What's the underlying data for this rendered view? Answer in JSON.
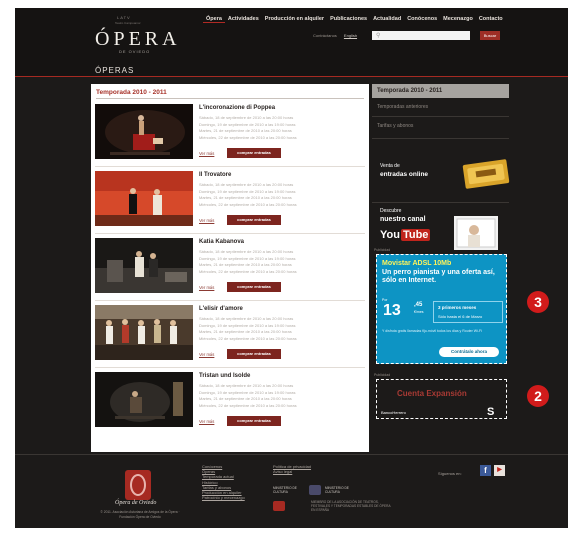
{
  "header": {
    "org_top": "LATV",
    "org_sub": "Teatro Campoamor",
    "logo": "ÓPERA",
    "logo_city": "DE OVIEDO",
    "nav": [
      "Ópera",
      "Actividades",
      "Producción en alquiler",
      "Publicaciones",
      "Actualidad",
      "Conócenos",
      "Mecenazgo",
      "Contacto"
    ],
    "contact_link": "Contráctanos",
    "lang_link": "English",
    "search_placeholder": "",
    "search_button": "Buscar"
  },
  "page_title": "ÓPERAS",
  "main": {
    "season_title": "Temporada 2010 - 2011",
    "more_label": "Ver más",
    "buy_label": "comprar entradas",
    "operas": [
      {
        "title": "L'incoronazione di Poppea",
        "dates": [
          "Sábado, 18 de septiembre de 2010 a las 20:00 horas",
          "Domingo, 19 de septiembre de 2010 a las 19:00 horas",
          "Martes, 21 de septiembre de 2010 a las 20:00 horas",
          "Miércoles, 22 de septiembre de 2010 a las 20:00 horas"
        ]
      },
      {
        "title": "Il Trovatore",
        "dates": [
          "Sábado, 18 de septiembre de 2010 a las 20:00 horas",
          "Domingo, 19 de septiembre de 2010 a las 19:00 horas",
          "Martes, 21 de septiembre de 2010 a las 20:00 horas",
          "Miércoles, 22 de septiembre de 2010 a las 20:00 horas"
        ]
      },
      {
        "title": "Katia Kabanova",
        "dates": [
          "Sábado, 18 de septiembre de 2010 a las 20:00 horas",
          "Domingo, 19 de septiembre de 2010 a las 19:00 horas",
          "Martes, 21 de septiembre de 2010 a las 20:00 horas",
          "Miércoles, 22 de septiembre de 2010 a las 20:00 horas"
        ]
      },
      {
        "title": "L'elisir d'amore",
        "dates": [
          "Sábado, 18 de septiembre de 2010 a las 20:00 horas",
          "Domingo, 19 de septiembre de 2010 a las 19:00 horas",
          "Martes, 21 de septiembre de 2010 a las 20:00 horas",
          "Miércoles, 22 de septiembre de 2010 a las 20:00 horas"
        ]
      },
      {
        "title": "Tristan und Isolde",
        "dates": [
          "Sábado, 18 de septiembre de 2010 a las 20:00 horas",
          "Domingo, 19 de septiembre de 2010 a las 19:00 horas",
          "Martes, 21 de septiembre de 2010 a las 20:00 horas",
          "Miércoles, 22 de septiembre de 2010 a las 20:00 horas"
        ]
      }
    ]
  },
  "sidebar": {
    "active": "Temporada 2010 - 2011",
    "items": [
      "Temporadas anteriores",
      "Tarifas y abonos"
    ],
    "promo_tickets_line1": "Venta de",
    "promo_tickets_line2": "entradas online",
    "promo_channel_line1": "Descubre",
    "promo_channel_line2": "nuestro canal",
    "youtube_you": "You",
    "youtube_tube": "Tube"
  },
  "ads": {
    "label": "Publicidad",
    "movistar": {
      "headline": "Movistar ADSL 10Mb",
      "body": "Un perro pianista y una oferta así, sólo en Internet.",
      "por": "Por",
      "price": "13",
      "cents": ",45",
      "unit": "€/mes",
      "box_line1": "3 primeros meses",
      "box_line2": "Sólo hasta el 6 de Marzo",
      "fine": "Y disfruta gratis llamadas fijo-móvil todos los días y Router Wi-Fi",
      "cta": "Contrátalo ahora"
    },
    "bank": {
      "headline": "Cuenta Expansión",
      "bank_name": "BancoHerrero",
      "logo": "S"
    }
  },
  "markers": [
    "3",
    "2"
  ],
  "footer": {
    "brand": "Ópera de Oviedo",
    "copyright": "© 2011. Asociación Asturiana de Amigos de la Ópera · Fundación Ópera de Oviedo",
    "col1": [
      "Conócenos",
      "Óperas",
      "Temporada actual",
      "Histórico",
      "Tarifas y abonos",
      "Producción en alquiler",
      "Patrocinio y mecenazgo"
    ],
    "col2": [
      "Política de privacidad",
      "Aviso legal"
    ],
    "badge1": "MINISTERIO DE CULTURA",
    "badge2": "MINISTERIO DE CULTURA",
    "member_text": "MIEMBRO DE LA ASOCIACIÓN DE TEATROS, FESTIVALES Y TEMPORADAS ESTABLES DE ÓPERA EN ESPAÑA",
    "follow": "Síguenos en:",
    "colors": {
      "accent": "#a62a22",
      "facebook": "#3b5998"
    }
  }
}
